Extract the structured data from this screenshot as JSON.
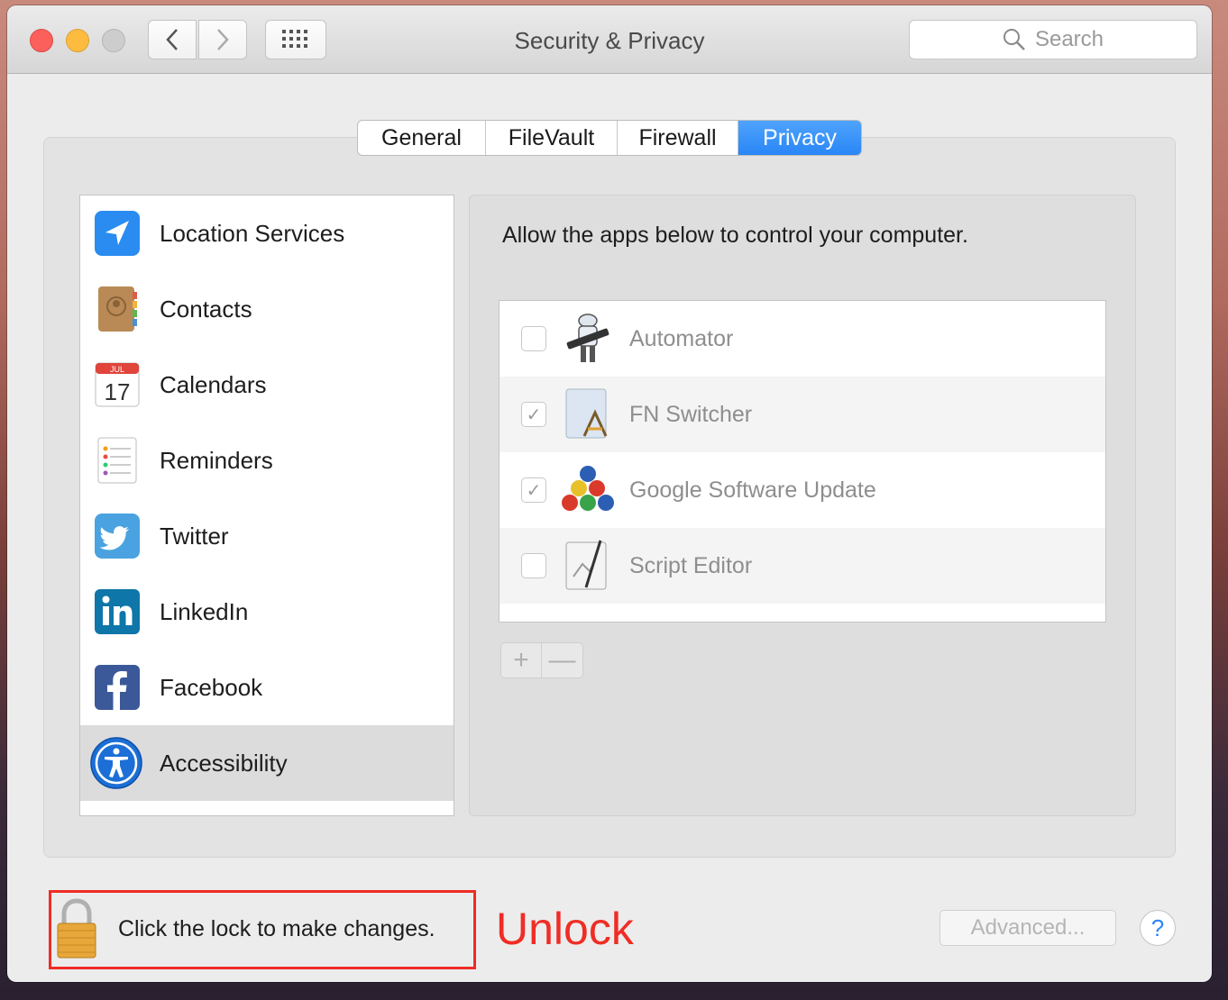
{
  "window": {
    "title": "Security & Privacy"
  },
  "search": {
    "placeholder": "Search"
  },
  "tabs": [
    {
      "label": "General"
    },
    {
      "label": "FileVault"
    },
    {
      "label": "Firewall"
    },
    {
      "label": "Privacy"
    }
  ],
  "active_tab": "Privacy",
  "sidebar": {
    "items": [
      {
        "label": "Location Services",
        "icon": "location-arrow-icon"
      },
      {
        "label": "Contacts",
        "icon": "contacts-book-icon"
      },
      {
        "label": "Calendars",
        "icon": "calendar-icon",
        "calendar_month": "JUL",
        "calendar_day": "17"
      },
      {
        "label": "Reminders",
        "icon": "reminders-icon"
      },
      {
        "label": "Twitter",
        "icon": "twitter-bird-icon"
      },
      {
        "label": "LinkedIn",
        "icon": "linkedin-icon"
      },
      {
        "label": "Facebook",
        "icon": "facebook-icon"
      },
      {
        "label": "Accessibility",
        "icon": "accessibility-icon"
      }
    ],
    "selected": "Accessibility"
  },
  "privacy_panel": {
    "description": "Allow the apps below to control your computer.",
    "apps": [
      {
        "name": "Automator",
        "checked": false,
        "icon": "automator-robot-icon"
      },
      {
        "name": "FN Switcher",
        "checked": true,
        "icon": "fn-switcher-app-icon"
      },
      {
        "name": "Google Software Update",
        "checked": true,
        "icon": "google-software-update-icon"
      },
      {
        "name": "Script Editor",
        "checked": false,
        "icon": "script-editor-icon"
      }
    ],
    "add_label": "+",
    "remove_label": "—"
  },
  "footer": {
    "lock_text": "Click the lock to make changes.",
    "annotation": "Unlock",
    "advanced_label": "Advanced...",
    "help_label": "?"
  },
  "colors": {
    "accent": "#2a86f7",
    "annotation_red": "#ef2d25"
  }
}
